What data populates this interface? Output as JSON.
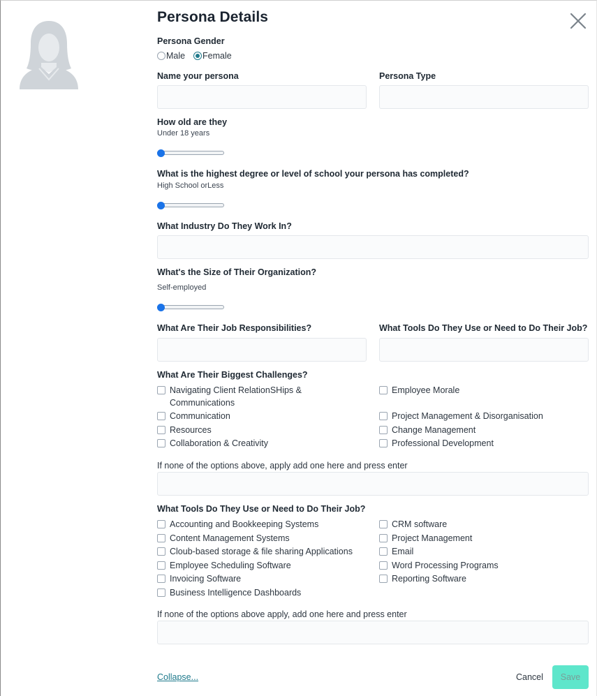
{
  "modal": {
    "title": "Persona Details",
    "close_icon": "close-icon",
    "avatar_icon": "female-avatar-icon"
  },
  "gender": {
    "label": "Persona Gender",
    "options": [
      {
        "label": "Male",
        "selected": false
      },
      {
        "label": "Female",
        "selected": true
      }
    ]
  },
  "name": {
    "label": "Name your persona",
    "value": ""
  },
  "persona_type": {
    "label": "Persona Type",
    "value": ""
  },
  "age": {
    "label": "How old are they",
    "value_text": "Under 18 years",
    "level": 0
  },
  "education": {
    "label": "What is the highest degree or level of school your persona has completed?",
    "value_text": "High School orLess",
    "level": 0
  },
  "industry": {
    "label": "What Industry Do They Work In?",
    "value": ""
  },
  "org_size": {
    "label": "What's the Size of Their Organization?",
    "value_text": "Self-employed",
    "level": 0
  },
  "responsibilities": {
    "label": "What Are Their Job Responsibilities?",
    "value": ""
  },
  "tools_field": {
    "label": "What Tools Do They Use or Need to Do Their Job?",
    "value": ""
  },
  "challenges": {
    "label": "What Are Their Biggest Challenges?",
    "left": [
      {
        "label": "Navigating Client RelationSHips & Communications",
        "checked": false
      },
      {
        "label": "Communication",
        "checked": false
      },
      {
        "label": "Resources",
        "checked": false
      },
      {
        "label": "Collaboration & Creativity",
        "checked": false
      }
    ],
    "right": [
      {
        "label": "Employee Morale",
        "checked": false
      },
      {
        "label": "Project Management & Disorganisation",
        "checked": false
      },
      {
        "label": "Change Management",
        "checked": false
      },
      {
        "label": "Professional Development",
        "checked": false
      }
    ],
    "other_label": "If none of the options above, apply add one here and press enter",
    "other_value": ""
  },
  "tools": {
    "label": "What Tools Do They Use or Need to Do Their Job?",
    "left": [
      {
        "label": "Accounting and Bookkeeping Systems",
        "checked": false
      },
      {
        "label": "Content Management Systems",
        "checked": false
      },
      {
        "label": "Cloub-based storage & file sharing Applications",
        "checked": false
      },
      {
        "label": "Employee Scheduling Software",
        "checked": false
      },
      {
        "label": "Invoicing Software",
        "checked": false
      },
      {
        "label": "Business Intelligence Dashboards",
        "checked": false
      }
    ],
    "right": [
      {
        "label": "CRM software",
        "checked": false
      },
      {
        "label": "Project Management",
        "checked": false
      },
      {
        "label": "Email",
        "checked": false
      },
      {
        "label": "Word Processing Programs",
        "checked": false
      },
      {
        "label": "Reporting Software",
        "checked": false
      }
    ],
    "other_label": "If none of the options above apply, add one here and press enter",
    "other_value": ""
  },
  "footer": {
    "collapse_label": "Collapse...",
    "cancel_label": "Cancel",
    "save_label": "Save"
  },
  "colors": {
    "accent": "#1f7a8c",
    "save_button": "#5ee6cb",
    "slider_thumb": "#1a73e8"
  }
}
